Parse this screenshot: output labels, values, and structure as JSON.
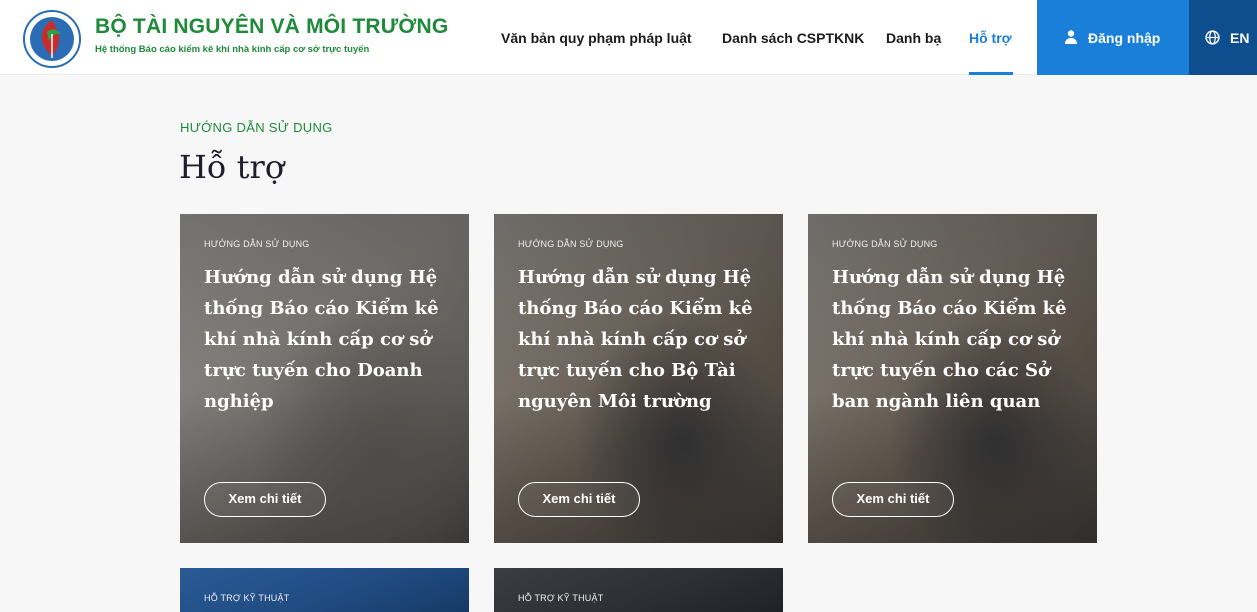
{
  "header": {
    "brand_title": "BỘ TÀI NGUYÊN VÀ MÔI TRƯỜNG",
    "brand_subtitle": "Hệ thống Báo cáo kiểm kê khí nhà kính cấp cơ sở trực tuyến",
    "logo_icon": "ministry-logo-icon",
    "nav": [
      {
        "label": "Văn bản quy phạm pháp luật",
        "active": false
      },
      {
        "label": "Danh sách CSPTKNK",
        "active": false
      },
      {
        "label": "Danh bạ",
        "active": false
      },
      {
        "label": "Hỗ trợ",
        "active": true
      }
    ],
    "login_label": "Đăng nhập",
    "login_icon": "user-icon",
    "lang_label": "EN",
    "lang_icon": "globe-icon",
    "accent_color": "#1a7fd8",
    "brand_color": "#1e8a3a"
  },
  "section": {
    "eyebrow": "HƯỚNG DẪN SỬ DỤNG",
    "title": "Hỗ trợ"
  },
  "cards": [
    {
      "tag": "HƯỚNG DẪN SỬ DỤNG",
      "title": "Hướng dẫn sử dụng Hệ thống Báo cáo Kiểm kê khí nhà kính cấp cơ sở trực tuyến cho Doanh nghiệp",
      "button": "Xem chi tiết"
    },
    {
      "tag": "HƯỚNG DẪN SỬ DỤNG",
      "title": "Hướng dẫn sử dụng Hệ thống Báo cáo Kiểm kê khí nhà kính cấp cơ sở trực tuyến cho Bộ Tài nguyên Môi trường",
      "button": "Xem chi tiết"
    },
    {
      "tag": "HƯỚNG DẪN SỬ DỤNG",
      "title": "Hướng dẫn sử dụng Hệ thống Báo cáo Kiểm kê khí nhà kính cấp cơ sở trực tuyến cho các Sở ban ngành liên quan",
      "button": "Xem chi tiết"
    },
    {
      "tag": "HỖ TRỢ KỸ THUẬT"
    },
    {
      "tag": "HỖ TRỢ KỸ THUẬT"
    }
  ]
}
